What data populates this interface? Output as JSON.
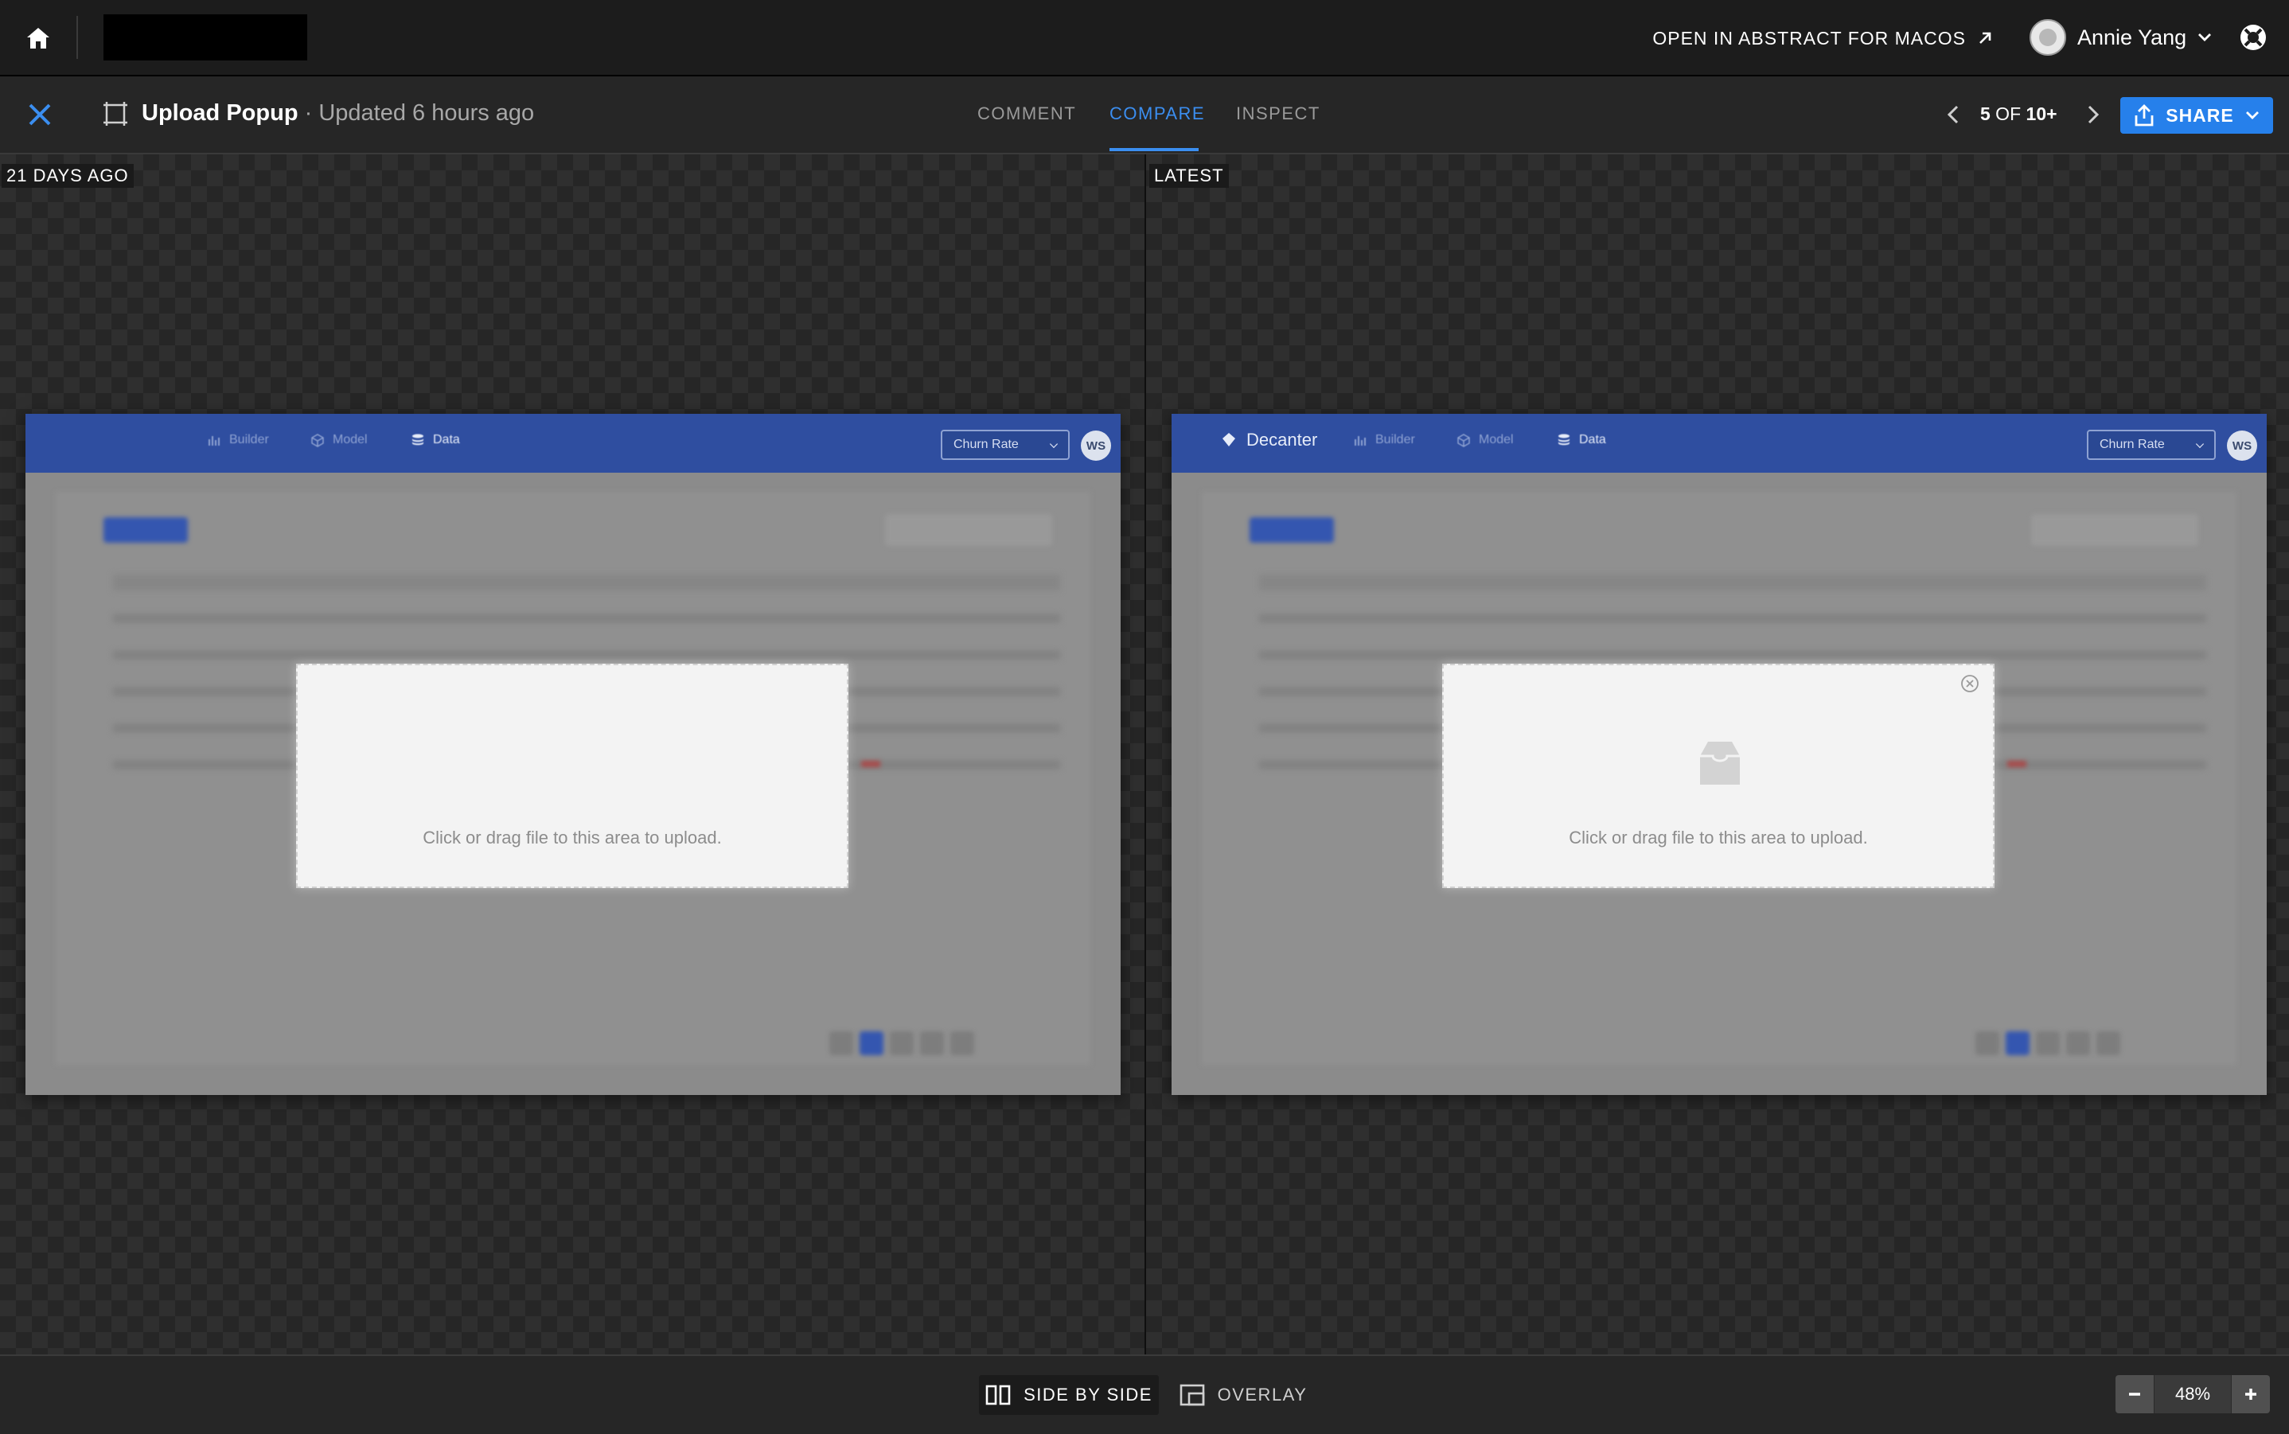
{
  "topbar": {
    "open_mac_label": "OPEN IN ABSTRACT FOR MACOS",
    "user_name": "Annie Yang"
  },
  "subbar": {
    "title": "Upload Popup",
    "separator": " · ",
    "updated": "Updated 6 hours ago",
    "tabs": [
      {
        "label": "COMMENT"
      },
      {
        "label": "COMPARE",
        "active": true
      },
      {
        "label": "INSPECT"
      }
    ],
    "pager_current": "5",
    "pager_of": " OF ",
    "pager_total": "10+",
    "share_label": "SHARE"
  },
  "compare": {
    "left_label": "21 DAYS AGO",
    "right_label": "LATEST",
    "left": {
      "nav": [
        "Builder",
        "Model",
        "Data"
      ],
      "dropdown": "Churn Rate",
      "avatar": "WS",
      "modal_text": "Click or drag file to this area to upload."
    },
    "right": {
      "brand": "Decanter",
      "nav": [
        "Builder",
        "Model",
        "Data"
      ],
      "dropdown": "Churn Rate",
      "avatar": "WS",
      "modal_text": "Click or drag file to this area to upload."
    }
  },
  "bottombar": {
    "side_by_side_label": "SIDE BY SIDE",
    "overlay_label": "OVERLAY",
    "zoom": "48%"
  },
  "colors": {
    "accent": "#2680eb",
    "tab_active": "#3b8ef0",
    "design_header": "#2f4ea0"
  }
}
